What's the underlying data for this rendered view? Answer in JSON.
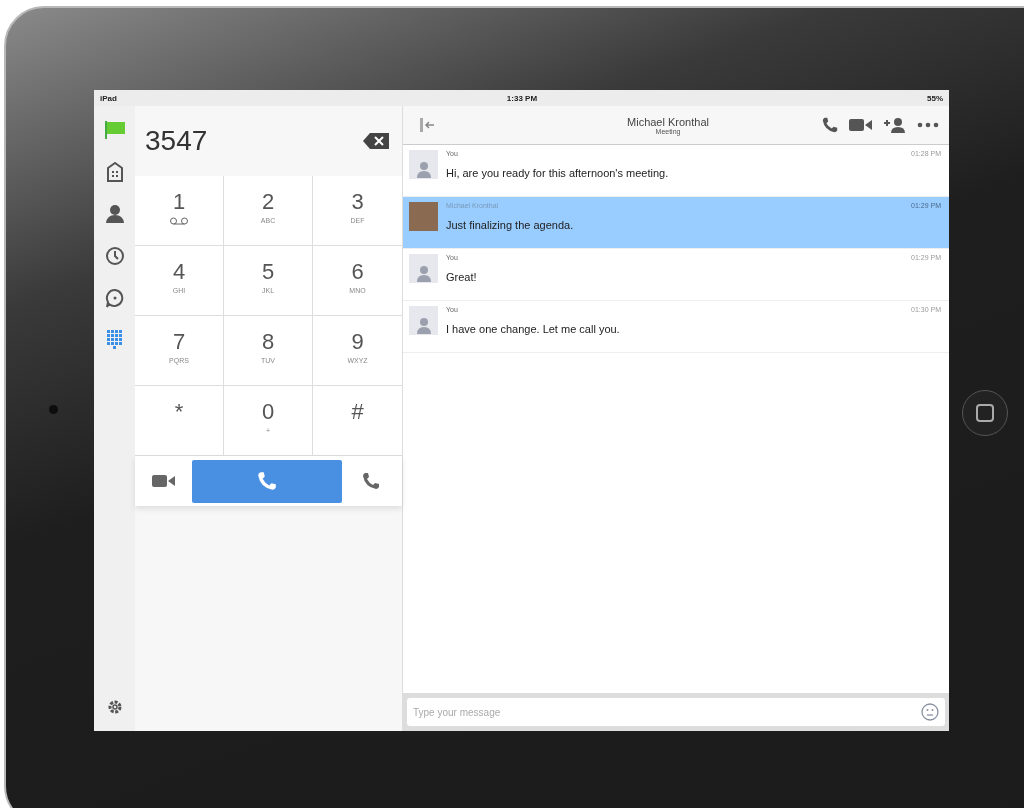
{
  "status_bar": {
    "device": "iPad",
    "time": "1:33 PM",
    "battery": "55%"
  },
  "sidebar": {
    "items": [
      {
        "kind": "flag",
        "selected": false
      },
      {
        "kind": "directory",
        "selected": false
      },
      {
        "kind": "contacts",
        "selected": false
      },
      {
        "kind": "history",
        "selected": false
      },
      {
        "kind": "messages",
        "selected": false
      },
      {
        "kind": "dialpad",
        "selected": true
      }
    ]
  },
  "dialer": {
    "number": "3547",
    "keys": [
      {
        "digit": "1",
        "kind": "voicemail"
      },
      {
        "digit": "2",
        "sub": "ABC"
      },
      {
        "digit": "3",
        "sub": "DEF"
      },
      {
        "digit": "4",
        "sub": "GHI"
      },
      {
        "digit": "5",
        "sub": "JKL"
      },
      {
        "digit": "6",
        "sub": "MNO"
      },
      {
        "digit": "7",
        "sub": "PQRS"
      },
      {
        "digit": "8",
        "sub": "TUV"
      },
      {
        "digit": "9",
        "sub": "WXYZ"
      },
      {
        "digit": "*"
      },
      {
        "digit": "0",
        "sub": "+"
      },
      {
        "digit": "#"
      }
    ]
  },
  "chat": {
    "title": "Michael Kronthal",
    "subtitle": "Meeting",
    "messages": [
      {
        "sender": "You",
        "time": "01:28 PM",
        "text": "Hi, are you ready for this afternoon's meeting.",
        "kind": "self",
        "selected": false
      },
      {
        "sender": "Michael Kronthal",
        "time": "01:29 PM",
        "text": "Just finalizing the agenda.",
        "kind": "contact",
        "selected": true
      },
      {
        "sender": "You",
        "time": "01:29 PM",
        "text": "Great!",
        "kind": "self",
        "selected": false
      },
      {
        "sender": "You",
        "time": "01:30 PM",
        "text": "I have one change. Let me call you.",
        "kind": "self",
        "selected": false
      }
    ],
    "composer": {
      "placeholder": "Type your message"
    }
  }
}
